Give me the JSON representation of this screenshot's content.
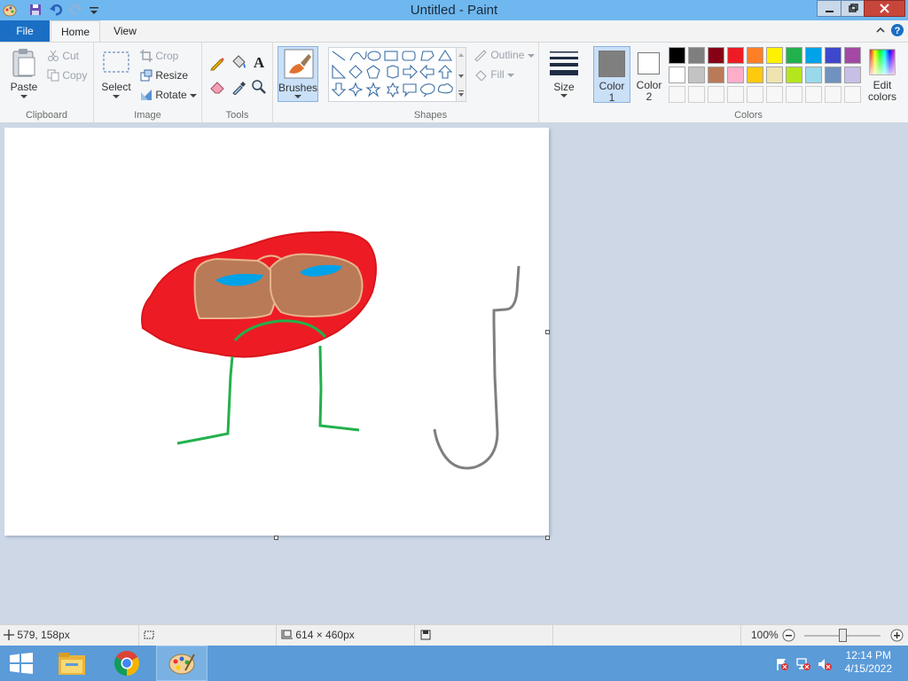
{
  "window": {
    "title": "Untitled - Paint"
  },
  "tabs": {
    "file": "File",
    "home": "Home",
    "view": "View"
  },
  "clipboard": {
    "paste": "Paste",
    "cut": "Cut",
    "copy": "Copy",
    "label": "Clipboard"
  },
  "image": {
    "select": "Select",
    "crop": "Crop",
    "resize": "Resize",
    "rotate": "Rotate",
    "label": "Image"
  },
  "tools": {
    "label": "Tools"
  },
  "brushes": {
    "label": "Brushes"
  },
  "shapes": {
    "outline": "Outline",
    "fill": "Fill",
    "label": "Shapes"
  },
  "size": {
    "label": "Size"
  },
  "colors": {
    "color1": "Color",
    "color1_num": "1",
    "color2": "Color",
    "color2_num": "2",
    "edit": "Edit",
    "edit2": "colors",
    "label": "Colors",
    "color1_value": "#7f7f7f",
    "color2_value": "#ffffff",
    "palette": [
      "#000000",
      "#7f7f7f",
      "#880015",
      "#ed1c24",
      "#ff7f27",
      "#fff200",
      "#22b14c",
      "#00a2e8",
      "#3f48cc",
      "#a349a4",
      "#ffffff",
      "#c3c3c3",
      "#b97a57",
      "#ffaec9",
      "#ffc90e",
      "#efe4b0",
      "#b5e61d",
      "#99d9ea",
      "#7092be",
      "#c8bfe7"
    ]
  },
  "status": {
    "cursor_pos": "579, 158px",
    "canvas_size": "614 × 460px",
    "zoom": "100%",
    "zoom_level": 0.5
  },
  "taskbar": {
    "time": "12:14 PM",
    "date": "4/15/2022"
  },
  "accent": {
    "file_tab": "#1a6fc4",
    "title_bar": "#6fb7ef",
    "taskbar": "#5b9bd8"
  }
}
